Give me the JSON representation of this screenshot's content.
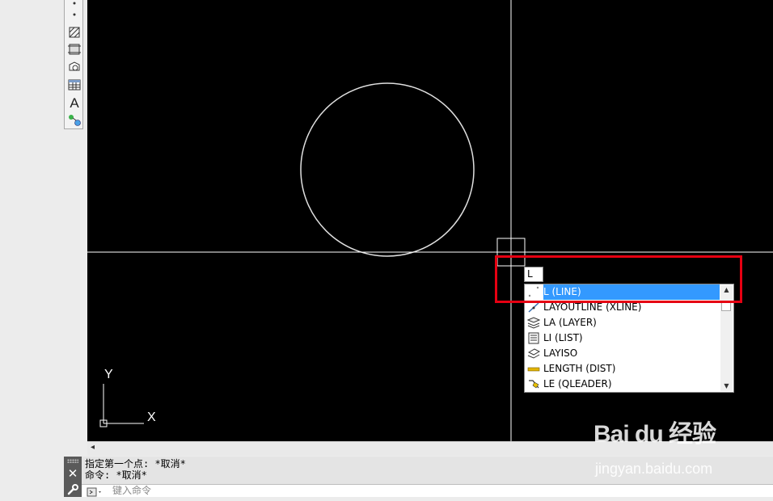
{
  "toolbar": {
    "tools": [
      "point-icon",
      "hatch-icon",
      "gradient-icon",
      "region-icon",
      "table-icon",
      "multiline-text-icon",
      "add-selected-icon"
    ],
    "text_tool_glyph": "A"
  },
  "canvas": {
    "ucs": {
      "x_label": "X",
      "y_label": "Y"
    }
  },
  "autocomplete": {
    "typed": "L",
    "suggestions": [
      {
        "label": "L (LINE)",
        "icon": "line-icon",
        "selected": true
      },
      {
        "label": "LAYOUTLINE (XLINE)",
        "icon": "xline-icon",
        "selected": false
      },
      {
        "label": "LA (LAYER)",
        "icon": "layer-icon",
        "selected": false
      },
      {
        "label": "LI (LIST)",
        "icon": "list-icon",
        "selected": false
      },
      {
        "label": "LAYISO",
        "icon": "layiso-icon",
        "selected": false
      },
      {
        "label": "LENGTH (DIST)",
        "icon": "dist-icon",
        "selected": false
      },
      {
        "label": "LE (QLEADER)",
        "icon": "qleader-icon",
        "selected": false
      }
    ]
  },
  "command_line": {
    "history": [
      "指定第一个点: *取消*",
      "命令: *取消*"
    ],
    "placeholder": "键入命令"
  },
  "watermark": {
    "logo": "Bai du 经验",
    "url": "jingyan.baidu.com"
  },
  "colors": {
    "canvas_bg": "#000000",
    "highlight": "#e60012",
    "selection": "#3399ff"
  }
}
